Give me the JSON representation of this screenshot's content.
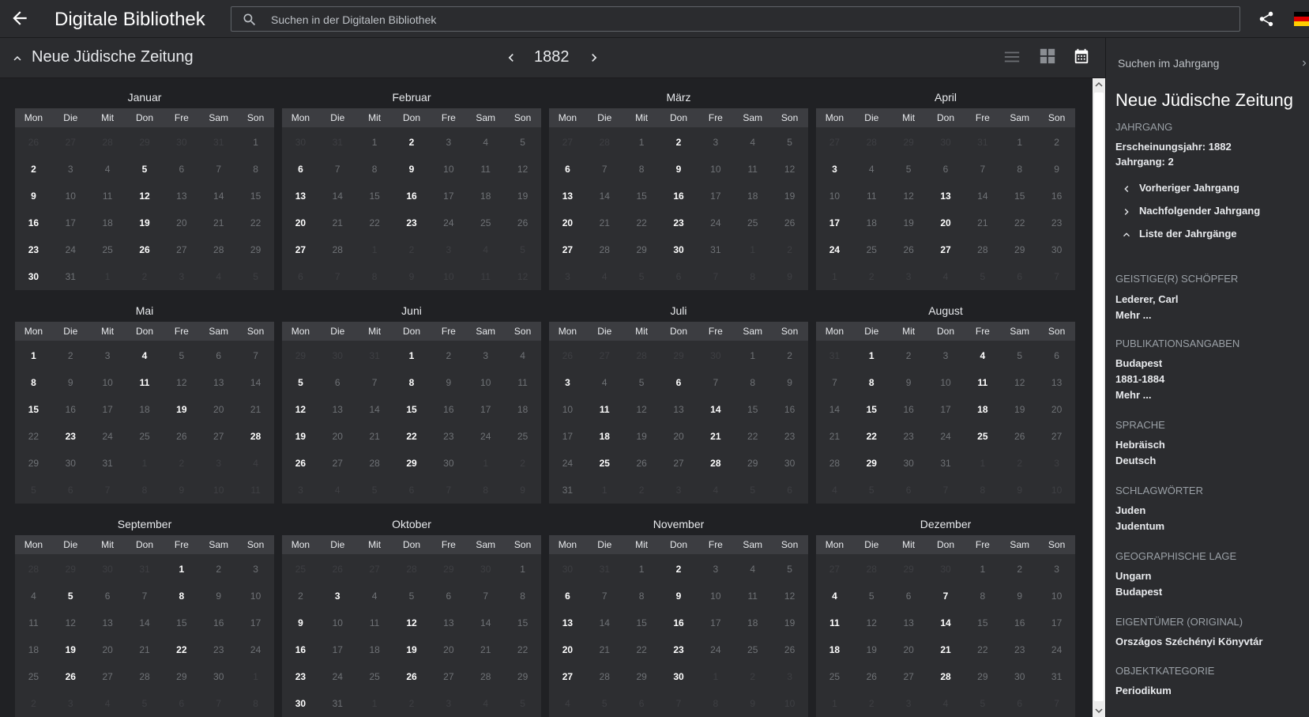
{
  "header": {
    "title": "Digitale Bibliothek",
    "search_placeholder": "Suchen in der Digitalen Bibliothek"
  },
  "toolbar": {
    "publication_title": "Neue Jüdische Zeitung",
    "year": "1882"
  },
  "calendar": {
    "weekdays": [
      "Mon",
      "Die",
      "Mit",
      "Don",
      "Fre",
      "Sam",
      "Son"
    ],
    "months": [
      {
        "name": "Januar",
        "weeks": [
          [
            26,
            27,
            28,
            29,
            30,
            31,
            1
          ],
          [
            2,
            3,
            4,
            5,
            6,
            7,
            8
          ],
          [
            9,
            10,
            11,
            12,
            13,
            14,
            15
          ],
          [
            16,
            17,
            18,
            19,
            20,
            21,
            22
          ],
          [
            23,
            24,
            25,
            26,
            27,
            28,
            29
          ],
          [
            30,
            31,
            1,
            2,
            3,
            4,
            5
          ]
        ],
        "issues": [
          2,
          5,
          9,
          12,
          16,
          19,
          23,
          26,
          30
        ]
      },
      {
        "name": "Februar",
        "weeks": [
          [
            30,
            31,
            1,
            2,
            3,
            4,
            5
          ],
          [
            6,
            7,
            8,
            9,
            10,
            11,
            12
          ],
          [
            13,
            14,
            15,
            16,
            17,
            18,
            19
          ],
          [
            20,
            21,
            22,
            23,
            24,
            25,
            26
          ],
          [
            27,
            28,
            1,
            2,
            3,
            4,
            5
          ],
          [
            6,
            7,
            8,
            9,
            10,
            11,
            12
          ]
        ],
        "issues": [
          2,
          6,
          9,
          13,
          16,
          20,
          23,
          27
        ]
      },
      {
        "name": "März",
        "weeks": [
          [
            27,
            28,
            1,
            2,
            3,
            4,
            5
          ],
          [
            6,
            7,
            8,
            9,
            10,
            11,
            12
          ],
          [
            13,
            14,
            15,
            16,
            17,
            18,
            19
          ],
          [
            20,
            21,
            22,
            23,
            24,
            25,
            26
          ],
          [
            27,
            28,
            29,
            30,
            31,
            1,
            2
          ],
          [
            3,
            4,
            5,
            6,
            7,
            8,
            9
          ]
        ],
        "issues": [
          2,
          6,
          9,
          13,
          16,
          20,
          23,
          27,
          30
        ]
      },
      {
        "name": "April",
        "weeks": [
          [
            27,
            28,
            29,
            30,
            31,
            1,
            2
          ],
          [
            3,
            4,
            5,
            6,
            7,
            8,
            9
          ],
          [
            10,
            11,
            12,
            13,
            14,
            15,
            16
          ],
          [
            17,
            18,
            19,
            20,
            21,
            22,
            23
          ],
          [
            24,
            25,
            26,
            27,
            28,
            29,
            30
          ],
          [
            1,
            2,
            3,
            4,
            5,
            6,
            7
          ]
        ],
        "issues": [
          3,
          13,
          17,
          20,
          24,
          27
        ]
      },
      {
        "name": "Mai",
        "weeks": [
          [
            1,
            2,
            3,
            4,
            5,
            6,
            7
          ],
          [
            8,
            9,
            10,
            11,
            12,
            13,
            14
          ],
          [
            15,
            16,
            17,
            18,
            19,
            20,
            21
          ],
          [
            22,
            23,
            24,
            25,
            26,
            27,
            28
          ],
          [
            29,
            30,
            31,
            1,
            2,
            3,
            4
          ],
          [
            5,
            6,
            7,
            8,
            9,
            10,
            11
          ]
        ],
        "issues": [
          1,
          4,
          8,
          11,
          15,
          19,
          23,
          28
        ]
      },
      {
        "name": "Juni",
        "weeks": [
          [
            29,
            30,
            31,
            1,
            2,
            3,
            4
          ],
          [
            5,
            6,
            7,
            8,
            9,
            10,
            11
          ],
          [
            12,
            13,
            14,
            15,
            16,
            17,
            18
          ],
          [
            19,
            20,
            21,
            22,
            23,
            24,
            25
          ],
          [
            26,
            27,
            28,
            29,
            30,
            1,
            2
          ],
          [
            3,
            4,
            5,
            6,
            7,
            8,
            9
          ]
        ],
        "issues": [
          1,
          5,
          8,
          12,
          15,
          19,
          22,
          26,
          29
        ]
      },
      {
        "name": "Juli",
        "weeks": [
          [
            26,
            27,
            28,
            29,
            30,
            1,
            2
          ],
          [
            3,
            4,
            5,
            6,
            7,
            8,
            9
          ],
          [
            10,
            11,
            12,
            13,
            14,
            15,
            16
          ],
          [
            17,
            18,
            19,
            20,
            21,
            22,
            23
          ],
          [
            24,
            25,
            26,
            27,
            28,
            29,
            30
          ],
          [
            31,
            1,
            2,
            3,
            4,
            5,
            6
          ]
        ],
        "issues": [
          3,
          6,
          11,
          14,
          18,
          21,
          25,
          28
        ]
      },
      {
        "name": "August",
        "weeks": [
          [
            31,
            1,
            2,
            3,
            4,
            5,
            6
          ],
          [
            7,
            8,
            9,
            10,
            11,
            12,
            13
          ],
          [
            14,
            15,
            16,
            17,
            18,
            19,
            20
          ],
          [
            21,
            22,
            23,
            24,
            25,
            26,
            27
          ],
          [
            28,
            29,
            30,
            31,
            1,
            2,
            3
          ],
          [
            4,
            5,
            6,
            7,
            8,
            9,
            10
          ]
        ],
        "issues": [
          1,
          4,
          8,
          11,
          15,
          18,
          22,
          25,
          29
        ]
      },
      {
        "name": "September",
        "weeks": [
          [
            28,
            29,
            30,
            31,
            1,
            2,
            3
          ],
          [
            4,
            5,
            6,
            7,
            8,
            9,
            10
          ],
          [
            11,
            12,
            13,
            14,
            15,
            16,
            17
          ],
          [
            18,
            19,
            20,
            21,
            22,
            23,
            24
          ],
          [
            25,
            26,
            27,
            28,
            29,
            30,
            1
          ],
          [
            2,
            3,
            4,
            5,
            6,
            7,
            8
          ]
        ],
        "issues": [
          1,
          5,
          8,
          19,
          22,
          26
        ]
      },
      {
        "name": "Oktober",
        "weeks": [
          [
            25,
            26,
            27,
            28,
            29,
            30,
            1
          ],
          [
            2,
            3,
            4,
            5,
            6,
            7,
            8
          ],
          [
            9,
            10,
            11,
            12,
            13,
            14,
            15
          ],
          [
            16,
            17,
            18,
            19,
            20,
            21,
            22
          ],
          [
            23,
            24,
            25,
            26,
            27,
            28,
            29
          ],
          [
            30,
            31,
            1,
            2,
            3,
            4,
            5
          ]
        ],
        "issues": [
          3,
          9,
          12,
          16,
          19,
          23,
          26,
          30
        ]
      },
      {
        "name": "November",
        "weeks": [
          [
            30,
            31,
            1,
            2,
            3,
            4,
            5
          ],
          [
            6,
            7,
            8,
            9,
            10,
            11,
            12
          ],
          [
            13,
            14,
            15,
            16,
            17,
            18,
            19
          ],
          [
            20,
            21,
            22,
            23,
            24,
            25,
            26
          ],
          [
            27,
            28,
            29,
            30,
            1,
            2,
            3
          ],
          [
            4,
            5,
            6,
            7,
            8,
            9,
            10
          ]
        ],
        "issues": [
          2,
          6,
          9,
          13,
          16,
          20,
          23,
          27,
          30
        ]
      },
      {
        "name": "Dezember",
        "weeks": [
          [
            27,
            28,
            29,
            30,
            1,
            2,
            3
          ],
          [
            4,
            5,
            6,
            7,
            8,
            9,
            10
          ],
          [
            11,
            12,
            13,
            14,
            15,
            16,
            17
          ],
          [
            18,
            19,
            20,
            21,
            22,
            23,
            24
          ],
          [
            25,
            26,
            27,
            28,
            29,
            30,
            31
          ],
          [
            1,
            2,
            3,
            4,
            5,
            6,
            7
          ]
        ],
        "issues": [
          4,
          7,
          11,
          14,
          18,
          21,
          28
        ]
      }
    ]
  },
  "sidepanel": {
    "search_label": "Suchen im Jahrgang",
    "title": "Neue Jüdische Zeitung",
    "volume_heading": "JAHRGANG",
    "publication_year": "Erscheinungsjahr: 1882",
    "volume": "Jahrgang: 2",
    "prev_volume": "Vorheriger Jahrgang",
    "next_volume": "Nachfolgender Jahrgang",
    "volume_list": "Liste der Jahrgänge",
    "creator_heading": "GEISTIGE(R) SCHÖPFER",
    "creator": "Lederer, Carl",
    "more_1": "Mehr ...",
    "publication_heading": "PUBLIKATIONSANGABEN",
    "place": "Budapest",
    "years": "1881-1884",
    "more_2": "Mehr ...",
    "language_heading": "SPRACHE",
    "language_1": "Hebräisch",
    "language_2": "Deutsch",
    "keywords_heading": "SCHLAGWÖRTER",
    "keyword_1": "Juden",
    "keyword_2": "Judentum",
    "geo_heading": "GEOGRAPHISCHE LAGE",
    "geo_1": "Ungarn",
    "geo_2": "Budapest",
    "owner_heading": "EIGENTÜMER (ORIGINAL)",
    "owner": "Országos Széchényi Könyvtár",
    "category_heading": "OBJEKTKATEGORIE",
    "category": "Periodikum"
  },
  "colors": {
    "background": "#202124",
    "bar": "#2b2c2f",
    "calendar_body": "#2d2e31",
    "weekday_header": "#3c3d41",
    "issue_day": "#ffffff",
    "empty_day": "#6f7276"
  },
  "icons": [
    "arrow-back-icon",
    "search-icon",
    "share-icon",
    "flag-de-icon",
    "chevron-up-icon",
    "chevron-left-icon",
    "chevron-right-icon",
    "list-view-icon",
    "grid-view-icon",
    "calendar-view-icon",
    "close-icon"
  ]
}
